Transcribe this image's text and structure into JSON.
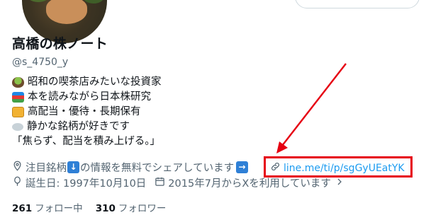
{
  "profile": {
    "name": "高橋の株ノート",
    "handle": "@s_4750_y"
  },
  "bio": [
    {
      "icon": "bowl-icon",
      "text": "昭和の喫茶店みたいな投資家"
    },
    {
      "icon": "books-icon",
      "text": "本を読みながら日本株研究"
    },
    {
      "icon": "gift-icon",
      "text": "高配当・優待・長期保有"
    },
    {
      "icon": "cloud-icon",
      "text": "静かな銘柄が好きです"
    },
    {
      "icon": "",
      "text": "「焦らず、配当を積み上げる。」"
    }
  ],
  "meta": {
    "location_part1": "注目銘柄",
    "location_part2": "の情報を無料でシェアしています",
    "link": "line.me/ti/p/sgGyUEatYK",
    "birthday": "誕生日: 1997年10月10日",
    "joined": "2015年7月からXを利用しています"
  },
  "stats": {
    "following_count": "261",
    "following_label": "フォロー中",
    "followers_count": "310",
    "followers_label": "フォロワー"
  },
  "colors": {
    "link": "#1d9bf0",
    "annotation": "#e60012",
    "muted": "#536471"
  }
}
